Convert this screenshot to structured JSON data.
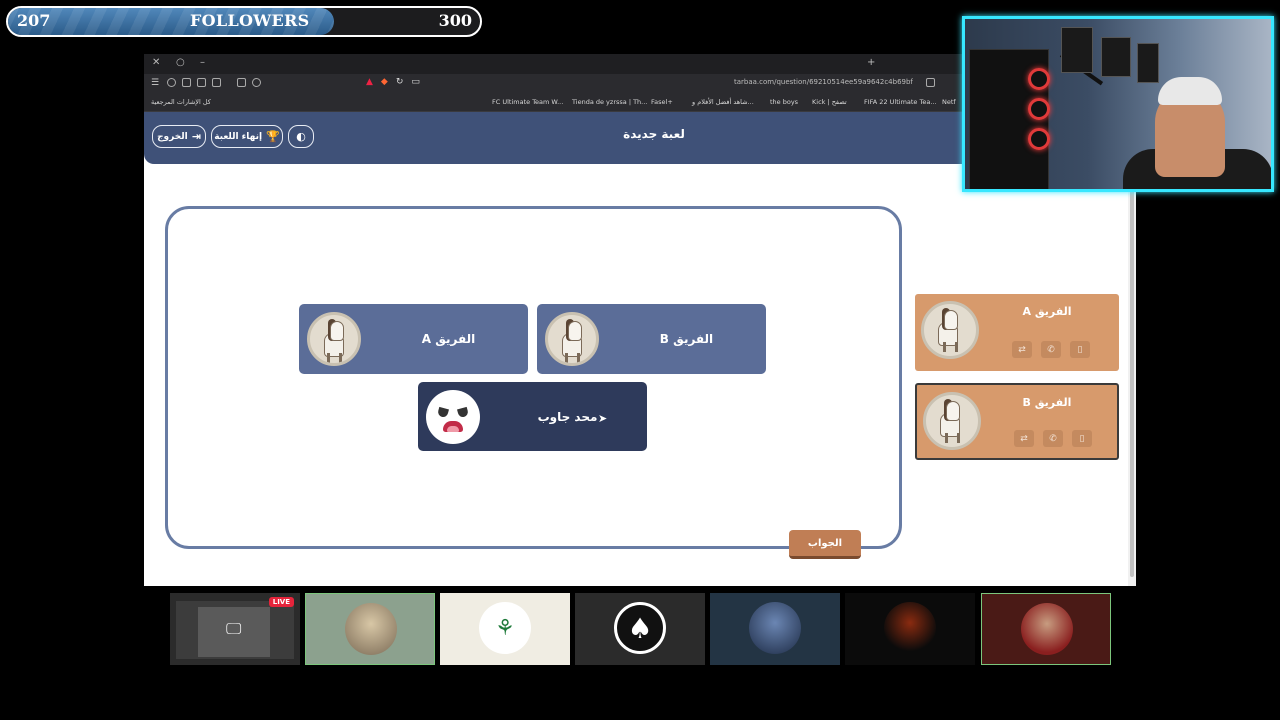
{
  "followers": {
    "current": "207",
    "label": "FOLLOWERS",
    "goal": "300",
    "progress": 0.69
  },
  "browser": {
    "url": "tarbaa.com/question/69210514ee59a9642c4b69bf",
    "bookmarks": [
      "كل الإشارات المرجعية",
      "FC Ultimate Team W...",
      "Tienda de yzrssa | Th...",
      "Fasel+",
      "شاهد أفضل الأفلام و...",
      "the boys",
      "Kick | تصفح",
      "FIFA 22 Ultimate Tea...",
      "Netf"
    ]
  },
  "header": {
    "title": "لعبة جديدة",
    "exit_label": "الخروج",
    "end_game_label": "إنهاء اللعبة"
  },
  "board": {
    "team_a": "الفريق A",
    "team_b": "الفريق B",
    "nobody": "محد جاوب",
    "answer_label": "الجواب"
  },
  "scoreboard": [
    {
      "name": "الفريق A",
      "active": false
    },
    {
      "name": "الفريق B",
      "active": true
    }
  ],
  "participants": {
    "live_badge": "LIVE"
  },
  "colors": {
    "header": "#3f5178",
    "team_card": "#5b6d98",
    "score_card": "#d79a6c",
    "webcam_border": "#37e7ff"
  }
}
